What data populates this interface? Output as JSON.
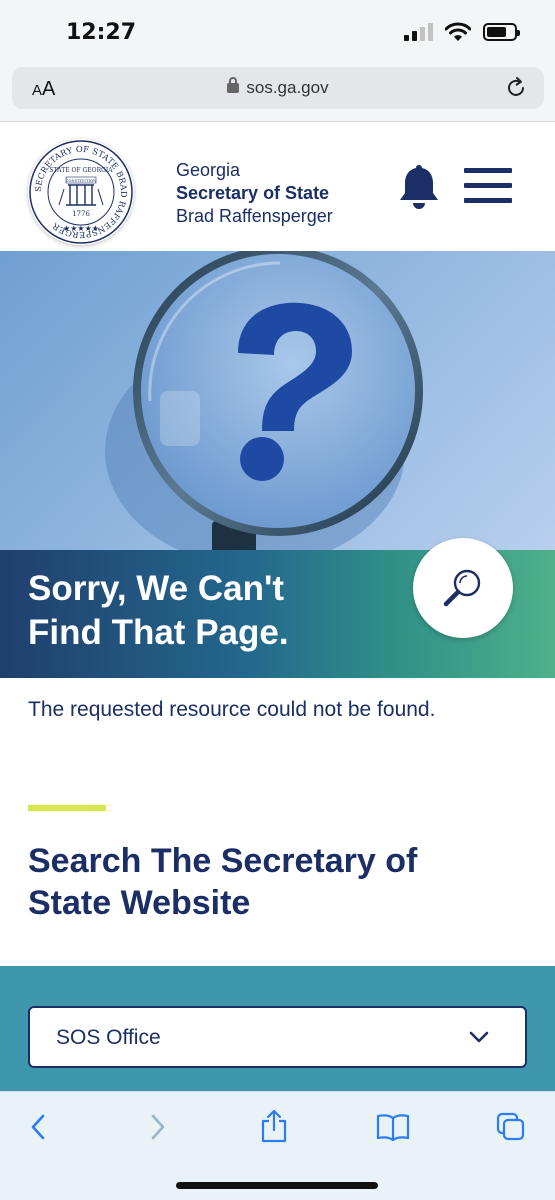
{
  "status_bar": {
    "time": "12:27"
  },
  "browser": {
    "aa_label_big": "A",
    "aa_label_small": "A",
    "url": "sos.ga.gov"
  },
  "header": {
    "brand_line1": "Georgia",
    "brand_line2": "Secretary of State",
    "brand_line3": "Brad Raffensperger",
    "seal": {
      "ring_text": "SECRETARY OF STATE BRAD RAFFENSPERGER",
      "inner_text": "STATE OF GEORGIA",
      "banner": "CONSTITUTION",
      "year": "1776",
      "stars": "★★★★★"
    }
  },
  "hero": {
    "icon": "magnifying-glass-question-mark"
  },
  "error": {
    "title_line1": "Sorry, We Can't",
    "title_line2": "Find That Page.",
    "message": "The requested resource could not be found."
  },
  "search_section": {
    "title_line1": "Search The Secretary of",
    "title_line2": "State Website",
    "select_value": "SOS Office"
  },
  "colors": {
    "navy": "#1b2f66",
    "accent_yellow": "#d8e84a",
    "panel_teal": "#3f97ad",
    "banner_start": "#1f3f6e",
    "banner_end": "#4fb08a"
  }
}
